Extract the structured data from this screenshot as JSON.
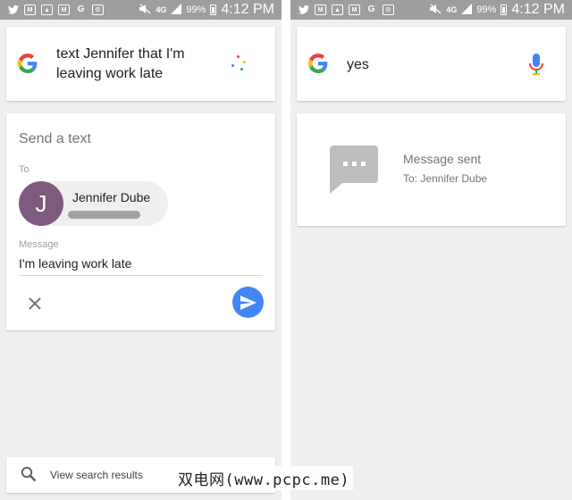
{
  "status_bar": {
    "network": "4G",
    "battery": "99%",
    "time": "4:12 PM",
    "notification_icons": [
      "twitter-icon",
      "gmail-icon",
      "image-icon",
      "gmail-icon",
      "google-icon",
      "settings-icon"
    ]
  },
  "left": {
    "query": "text Jennifer that I'm leaving work late",
    "card_title": "Send a text",
    "to_label": "To",
    "contact_initial": "J",
    "contact_name": "Jennifer Dube",
    "message_label": "Message",
    "message": "I'm leaving work late",
    "search_results_label": "View search results"
  },
  "right": {
    "query": "yes",
    "sent_title": "Message sent",
    "sent_to": "To: Jennifer Dube"
  },
  "watermark": "双电网(www.pcpc.me)",
  "colors": {
    "status_bar": "#9e9e9e",
    "background": "#efefef",
    "accent_blue": "#4285f4",
    "avatar": "#7e5a7e"
  }
}
